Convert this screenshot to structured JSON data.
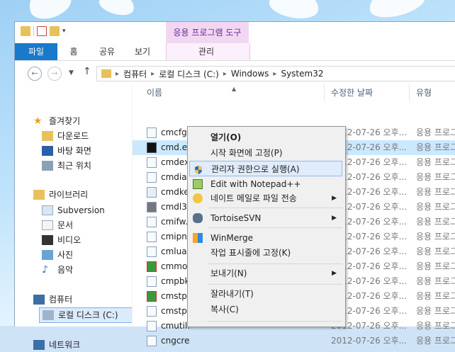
{
  "ribbon": {
    "context_group": "응용 프로그램 도구",
    "tabs": [
      "파일",
      "홈",
      "공유",
      "보기",
      "관리"
    ]
  },
  "address": {
    "breadcrumb": [
      "컴퓨터",
      "로컬 디스크 (C:)",
      "Windows",
      "System32"
    ]
  },
  "nav": {
    "favorites": "즐겨찾기",
    "fav_items": [
      "다운로드",
      "바탕 화면",
      "최근 위치"
    ],
    "libraries": "라이브러리",
    "lib_items": [
      "Subversion",
      "문서",
      "비디오",
      "사진",
      "음악"
    ],
    "computer": "컴퓨터",
    "computer_items": [
      "로컬 디스크 (C:)"
    ],
    "network": "네트워크"
  },
  "list": {
    "headers": [
      "이름",
      "수정한 날짜",
      "유형"
    ],
    "rows": [
      {
        "name": "cmcfg32.dll",
        "date": "2012-07-26 오후...",
        "type": "응용 프로그"
      },
      {
        "name": "cmd.exe",
        "date": "2012-07-26 오후...",
        "type": "응용 프로그"
      },
      {
        "name": "cmdex",
        "date": "2012-07-26 오후...",
        "type": "응용 프로그"
      },
      {
        "name": "cmdial",
        "date": "2012-07-26 오후...",
        "type": "응용 프로그"
      },
      {
        "name": "cmdkey",
        "date": "2012-07-26 오후...",
        "type": "응용 프로그"
      },
      {
        "name": "cmdl32",
        "date": "2012-07-26 오후...",
        "type": "응용 프로그"
      },
      {
        "name": "cmifw.",
        "date": "2012-07-26 오후...",
        "type": "응용 프로그"
      },
      {
        "name": "cmipnp",
        "date": "2012-07-26 오후...",
        "type": "응용 프로그"
      },
      {
        "name": "cmlua.",
        "date": "2012-07-26 오후...",
        "type": "응용 프로그"
      },
      {
        "name": "cmmon",
        "date": "2012-07-26 오후...",
        "type": "응용 프로그"
      },
      {
        "name": "cmpbk",
        "date": "2012-07-26 오후...",
        "type": "응용 프로그"
      },
      {
        "name": "cmstp.",
        "date": "2012-07-26 오후...",
        "type": "응용 프로그"
      },
      {
        "name": "cmstpl",
        "date": "2012-07-26 오후...",
        "type": "응용 프로그"
      },
      {
        "name": "cmutil.",
        "date": "2012-07-26 오후...",
        "type": "응용 프로그"
      },
      {
        "name": "cngcre",
        "date": "2012-07-26 오후...",
        "type": "응용 프로그"
      }
    ]
  },
  "menu": {
    "items": [
      {
        "label": "열기(O)"
      },
      {
        "label": "시작 화면에 고정(P)"
      },
      {
        "label": "관리자 권한으로 실행(A)"
      },
      {
        "label": "Edit with Notepad++"
      },
      {
        "label": "네이트 메일로 파일 전송"
      },
      {
        "label": "TortoiseSVN"
      },
      {
        "label": "WinMerge"
      },
      {
        "label": "작업 표시줄에 고정(K)"
      },
      {
        "label": "보내기(N)"
      },
      {
        "label": "잘라내기(T)"
      },
      {
        "label": "복사(C)"
      }
    ]
  },
  "colors": {
    "file_tab": "#1979ca",
    "context_tools": "#f2d7f2",
    "selection": "#cce8ff",
    "menu_highlight": "#dfecfb"
  }
}
